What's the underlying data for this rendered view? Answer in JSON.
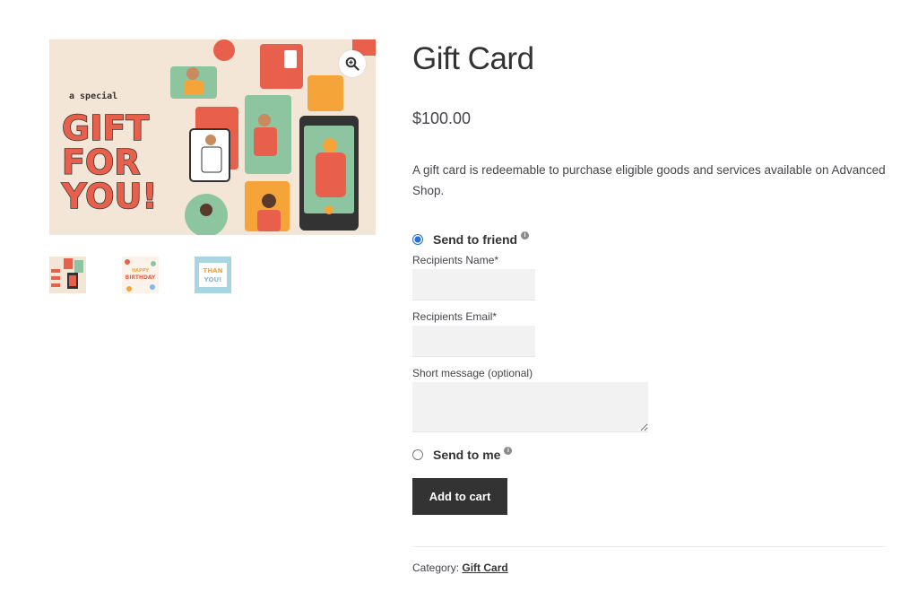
{
  "product": {
    "title": "Gift Card",
    "price": "$100.00",
    "description": "A gift card is redeemable to purchase eligible goods and services available on Advanced Shop."
  },
  "gallery": {
    "main_image_lines": [
      "a special",
      "GIFT",
      "FOR",
      "YOU!"
    ],
    "zoom_icon": "magnifier-plus-icon",
    "thumbnails": [
      {
        "name": "gift-for-you",
        "text": ""
      },
      {
        "name": "happy-birthday",
        "text": "HAPPY BIRTHDAY"
      },
      {
        "name": "thank-you",
        "text": "THANK YOU"
      }
    ]
  },
  "form": {
    "send_to_friend_label": "Send to friend",
    "send_to_friend_selected": true,
    "recipient_name_label": "Recipients Name*",
    "recipient_email_label": "Recipients Email*",
    "message_label": "Short message (optional)",
    "send_to_me_label": "Send to me",
    "send_to_me_selected": false,
    "info_icon": "info-icon",
    "info_glyph": "i"
  },
  "actions": {
    "add_to_cart_label": "Add to cart"
  },
  "meta": {
    "category_label": "Category:",
    "category_value": "Gift Card"
  },
  "colors": {
    "accent": "#333333",
    "field_bg": "#f2f2f2",
    "radio": "#2271e0",
    "gift_text": "#e8604c",
    "card_bg": "#f4e6d6"
  }
}
